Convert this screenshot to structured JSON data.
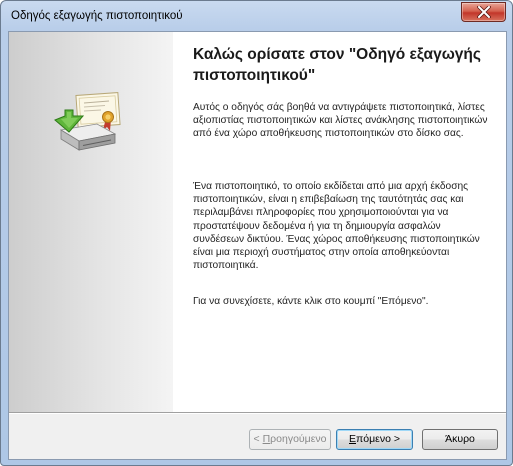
{
  "window": {
    "title": "Οδηγός εξαγωγής πιστοποιητικού"
  },
  "wizard": {
    "heading": "Καλώς ορίσατε στον \"Οδηγό εξαγωγής πιστοποιητικού\"",
    "paragraph1": "Αυτός ο οδηγός σάς βοηθά να αντιγράψετε πιστοποιητικά, λίστες αξιοπιστίας πιστοποιητικών και λίστες ανάκλησης πιστοποιητικών από ένα χώρο αποθήκευσης πιστοποιητικών στο δίσκο σας.",
    "paragraph2": "Ένα πιστοποιητικό, το οποίο εκδίδεται από μια αρχή έκδοσης πιστοποιητικών, είναι η επιβεβαίωση της ταυτότητάς σας και περιλαμβάνει πληροφορίες που χρησιμοποιούνται για να προστατέψουν δεδομένα ή για τη δημιουργία ασφαλών συνδέσεων δικτύου. Ένας χώρος αποθήκευσης πιστοποιητικών είναι μια περιοχή συστήματος στην οποία αποθηκεύονται πιστοποιητικά.",
    "paragraph3": "Για να συνεχίσετε, κάντε κλικ στο κουμπί \"Επόμενο\"."
  },
  "buttons": {
    "back": {
      "prefix": "< ",
      "mnemonic": "Π",
      "rest": "ροηγούμενο"
    },
    "next": {
      "mnemonic": "Ε",
      "rest": "πόμενο >"
    },
    "cancel": "Άκυρο"
  }
}
